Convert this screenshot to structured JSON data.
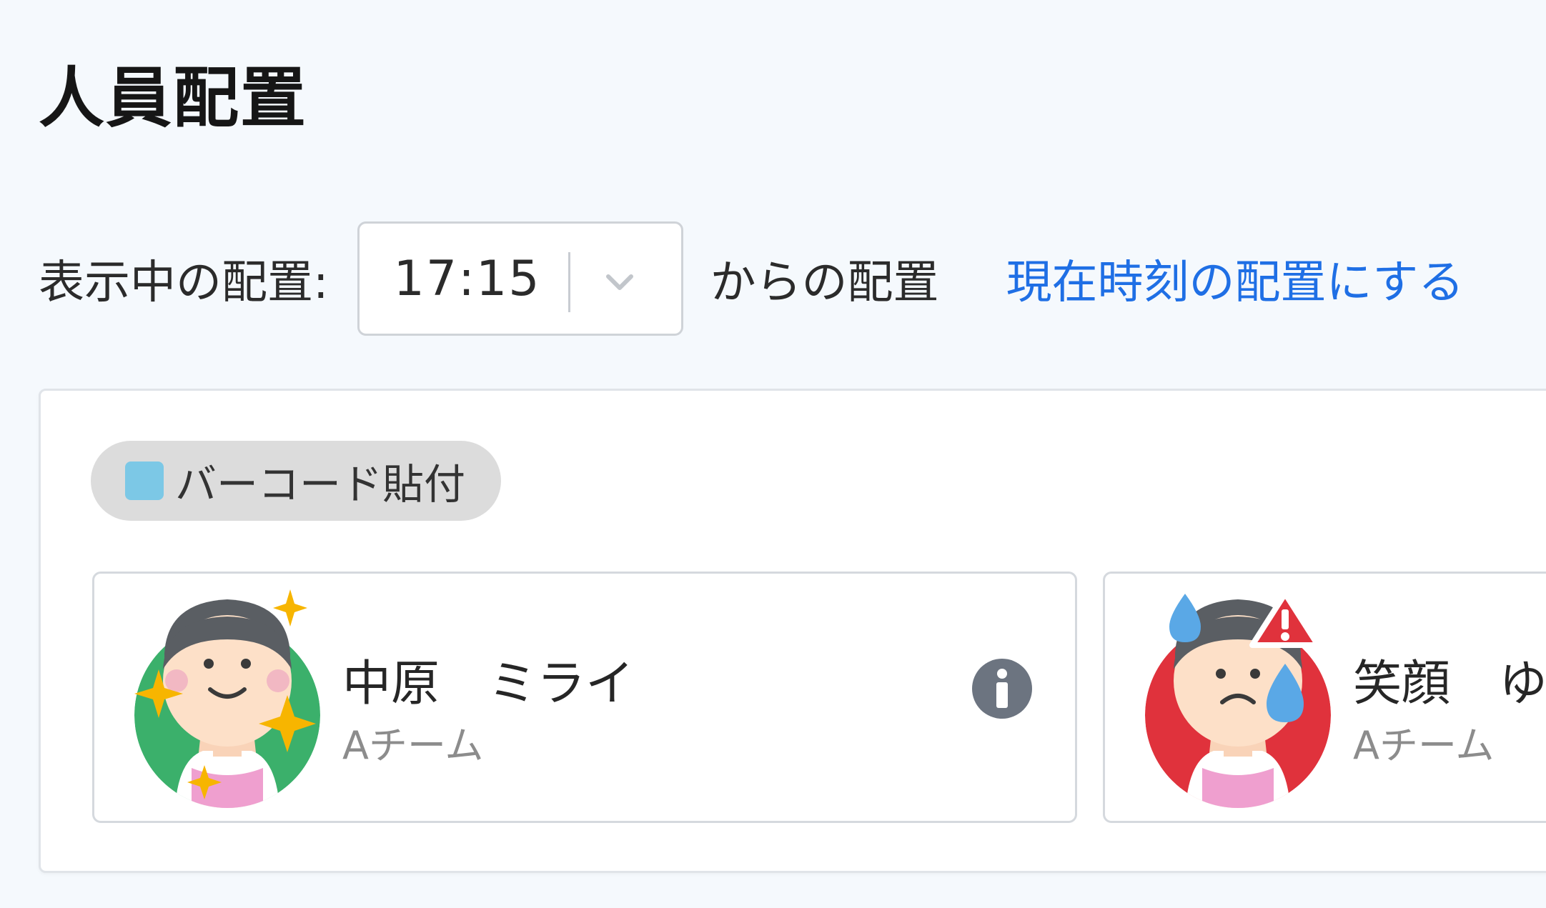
{
  "page": {
    "title": "人員配置"
  },
  "toolbar": {
    "label": "表示中の配置:",
    "time_value": "17:15",
    "suffix": "からの配置",
    "now_link": "現在時刻の配置にする"
  },
  "task": {
    "label": "バーコード貼付",
    "color": "#7cc8e6"
  },
  "staff": [
    {
      "name": "中原　ミライ",
      "team": "Aチーム",
      "status": "good",
      "avatar_bg": "#3bb06b",
      "icon": "info-icon"
    },
    {
      "name": "笑顔　ゆ",
      "team": "Aチーム",
      "status": "warning",
      "avatar_bg": "#e0323c",
      "icon": "warning-icon"
    }
  ],
  "colors": {
    "link": "#1f6fe5",
    "background": "#f5f9fd"
  }
}
